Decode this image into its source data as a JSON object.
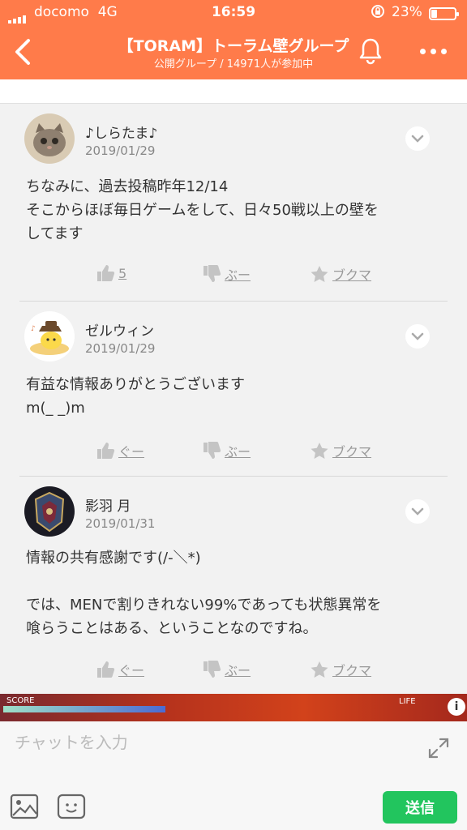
{
  "status_bar": {
    "carrier": "docomo",
    "network": "4G",
    "time": "16:59",
    "battery": "23%"
  },
  "header": {
    "title": "【TORAM】トーラム壁グループ",
    "subtitle": "公開グループ / 14971人が参加中"
  },
  "comments": [
    {
      "name": "♪しらたま♪",
      "date": "2019/01/29",
      "body": "ちなみに、過去投稿昨年12/14\nそこからほぼ毎日ゲームをして、日々50戦以上の壁を\nしてます",
      "like": "5",
      "boo": "ぶー",
      "fav": "ブクマ"
    },
    {
      "name": "ゼルウィン",
      "date": "2019/01/29",
      "body": "有益な情報ありがとうございます\nm(_ _)m",
      "like": "ぐー",
      "boo": "ぶー",
      "fav": "ブクマ"
    },
    {
      "name": "影羽 月",
      "date": "2019/01/31",
      "body": "情報の共有感謝です(/-＼*)\n\nでは、MENで割りきれない99%であっても状態異常を\n喰らうことはある、ということなのですね。",
      "like": "ぐー",
      "boo": "ぶー",
      "fav": "ブクマ"
    }
  ],
  "banner": {
    "score_label": "SCORE",
    "life_label": "LIFE"
  },
  "input": {
    "placeholder": "チャットを入力",
    "send_label": "送信"
  },
  "colors": {
    "header": "#ff7b4a",
    "send": "#22c55e"
  }
}
